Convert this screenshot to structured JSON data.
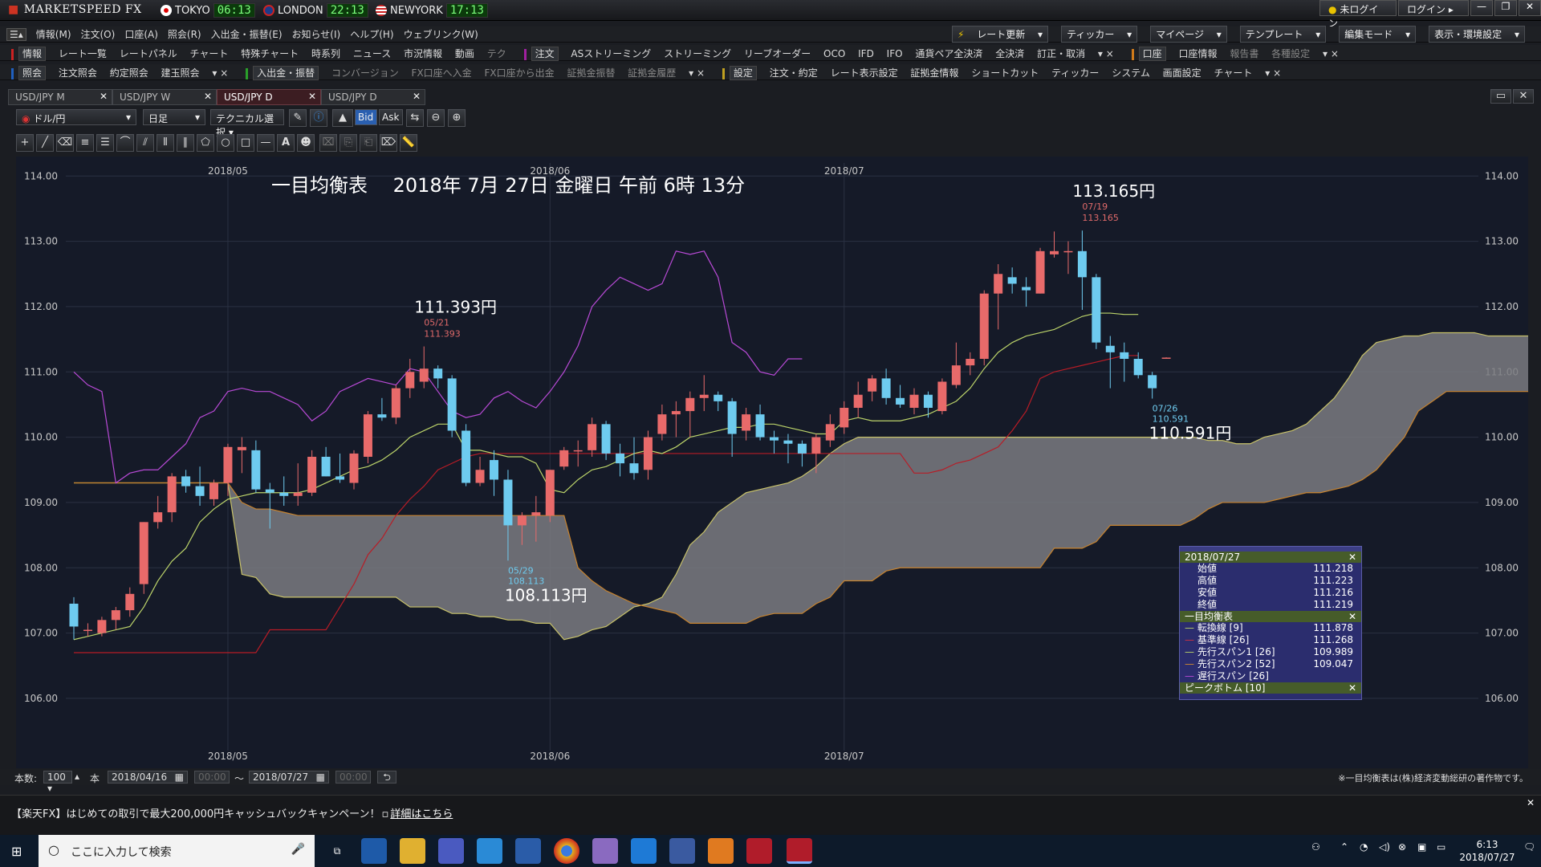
{
  "app": {
    "brand": "MARKETSPEED FX",
    "clocks": [
      {
        "city": "TOKYO",
        "time": "06:13"
      },
      {
        "city": "LONDON",
        "time": "22:13"
      },
      {
        "city": "NEWYORK",
        "time": "17:13"
      }
    ],
    "top_buttons": [
      "未ログイン",
      "ログイン"
    ]
  },
  "menu": [
    "情報(M)",
    "注文(O)",
    "口座(A)",
    "照会(R)",
    "入出金・振替(E)",
    "お知らせ(I)",
    "ヘルプ(H)",
    "ウェブリンク(W)"
  ],
  "menu_right": [
    "レート更新",
    "ティッカー",
    "マイページ",
    "テンプレート",
    "編集モード",
    "表示・環境設定"
  ],
  "toolbar1": {
    "info_tag": "情報",
    "info_items": [
      "レート一覧",
      "レートパネル",
      "チャート",
      "特殊チャート",
      "時系列",
      "ニュース",
      "市況情報",
      "動画",
      "テク"
    ],
    "order_tag": "注文",
    "order_items": [
      "ASストリーミング",
      "ストリーミング",
      "リーブオーダー",
      "OCO",
      "IFD",
      "IFO",
      "通貨ペア全決済",
      "全決済",
      "訂正・取消"
    ],
    "account_tag": "口座",
    "account_items": [
      "口座情報",
      "報告書",
      "各種設定"
    ]
  },
  "toolbar2": {
    "inquiry_tag": "照会",
    "inquiry_items": [
      "注文照会",
      "約定照会",
      "建玉照会"
    ],
    "transfer_tag": "入出金・振替",
    "transfer_items": [
      "コンバージョン",
      "FX口座へ入金",
      "FX口座から出金",
      "証拠金振替",
      "証拠金履歴"
    ],
    "settings_tag": "設定",
    "settings_items": [
      "注文・約定",
      "レート表示設定",
      "証拠金情報",
      "ショートカット",
      "ティッカー",
      "システム",
      "画面設定",
      "チャート"
    ]
  },
  "tabs": [
    {
      "label": "USD/JPY M",
      "active": false
    },
    {
      "label": "USD/JPY W",
      "active": false
    },
    {
      "label": "USD/JPY D",
      "active": true
    },
    {
      "label": "USD/JPY D",
      "active": false
    }
  ],
  "chart_toolbar": {
    "pair": "ドル/円",
    "period": "日足",
    "technical": "テクニカル選択",
    "bid": "Bid",
    "ask": "Ask"
  },
  "chart_data": {
    "type": "candlestick",
    "title": "一目均衡表　 2018年 7月 27日 金曜日 午前 6時 13分",
    "y_ticks": [
      "114.00",
      "113.00",
      "112.00",
      "111.00",
      "110.00",
      "109.00",
      "108.00",
      "107.00",
      "106.00"
    ],
    "ylim": [
      105.2,
      114.2
    ],
    "x_labels": [
      {
        "label": "2018/05",
        "index": 11
      },
      {
        "label": "2018/06",
        "index": 34
      },
      {
        "label": "2018/07",
        "index": 55
      }
    ],
    "annotations": [
      {
        "label": "111.393円",
        "date": "05/21",
        "value": "111.393",
        "index": 25
      },
      {
        "label": "108.113円",
        "date": "05/29",
        "value": "108.113",
        "index": 31
      },
      {
        "label": "113.165円",
        "date": "07/19",
        "value": "113.165",
        "index": 72
      },
      {
        "label": "110.591円",
        "date": "07/26",
        "value": "110.591",
        "index": 77
      }
    ],
    "candles": [
      {
        "o": 107.45,
        "h": 107.55,
        "l": 106.9,
        "c": 107.1
      },
      {
        "o": 107.05,
        "h": 107.15,
        "l": 106.95,
        "c": 107.05
      },
      {
        "o": 107.0,
        "h": 107.25,
        "l": 106.95,
        "c": 107.2
      },
      {
        "o": 107.2,
        "h": 107.4,
        "l": 107.05,
        "c": 107.35
      },
      {
        "o": 107.35,
        "h": 107.7,
        "l": 107.25,
        "c": 107.6
      },
      {
        "o": 107.75,
        "h": 108.7,
        "l": 107.6,
        "c": 108.7
      },
      {
        "o": 108.7,
        "h": 109.1,
        "l": 108.6,
        "c": 108.85
      },
      {
        "o": 108.85,
        "h": 109.45,
        "l": 108.7,
        "c": 109.4
      },
      {
        "o": 109.4,
        "h": 109.5,
        "l": 109.15,
        "c": 109.25
      },
      {
        "o": 109.25,
        "h": 109.55,
        "l": 108.95,
        "c": 109.1
      },
      {
        "o": 109.05,
        "h": 109.35,
        "l": 108.95,
        "c": 109.3
      },
      {
        "o": 109.3,
        "h": 109.9,
        "l": 109.1,
        "c": 109.85
      },
      {
        "o": 109.8,
        "h": 110.0,
        "l": 109.45,
        "c": 109.85
      },
      {
        "o": 109.8,
        "h": 109.95,
        "l": 109.15,
        "c": 109.2
      },
      {
        "o": 109.2,
        "h": 109.3,
        "l": 108.6,
        "c": 109.15
      },
      {
        "o": 109.15,
        "h": 109.4,
        "l": 108.95,
        "c": 109.1
      },
      {
        "o": 109.1,
        "h": 109.6,
        "l": 108.95,
        "c": 109.15
      },
      {
        "o": 109.15,
        "h": 109.8,
        "l": 109.1,
        "c": 109.7
      },
      {
        "o": 109.7,
        "h": 109.85,
        "l": 109.4,
        "c": 109.4
      },
      {
        "o": 109.4,
        "h": 109.75,
        "l": 109.3,
        "c": 109.35
      },
      {
        "o": 109.3,
        "h": 109.8,
        "l": 109.2,
        "c": 109.75
      },
      {
        "o": 109.7,
        "h": 110.4,
        "l": 109.6,
        "c": 110.35
      },
      {
        "o": 110.35,
        "h": 110.6,
        "l": 110.25,
        "c": 110.3
      },
      {
        "o": 110.3,
        "h": 110.8,
        "l": 110.2,
        "c": 110.75
      },
      {
        "o": 110.75,
        "h": 111.2,
        "l": 110.6,
        "c": 111.0
      },
      {
        "o": 110.85,
        "h": 111.39,
        "l": 110.75,
        "c": 111.05
      },
      {
        "o": 111.05,
        "h": 111.1,
        "l": 110.75,
        "c": 110.9
      },
      {
        "o": 110.9,
        "h": 110.95,
        "l": 110.0,
        "c": 110.1
      },
      {
        "o": 110.1,
        "h": 110.2,
        "l": 109.25,
        "c": 109.3
      },
      {
        "o": 109.3,
        "h": 109.7,
        "l": 109.25,
        "c": 109.5
      },
      {
        "o": 109.65,
        "h": 109.8,
        "l": 109.1,
        "c": 109.35
      },
      {
        "o": 109.35,
        "h": 109.5,
        "l": 108.11,
        "c": 108.65
      },
      {
        "o": 108.65,
        "h": 108.85,
        "l": 108.35,
        "c": 108.8
      },
      {
        "o": 108.8,
        "h": 109.1,
        "l": 108.4,
        "c": 108.85
      },
      {
        "o": 108.8,
        "h": 109.5,
        "l": 108.7,
        "c": 109.5
      },
      {
        "o": 109.55,
        "h": 109.85,
        "l": 109.5,
        "c": 109.8
      },
      {
        "o": 109.8,
        "h": 109.95,
        "l": 109.55,
        "c": 109.8
      },
      {
        "o": 109.8,
        "h": 110.3,
        "l": 109.7,
        "c": 110.2
      },
      {
        "o": 110.2,
        "h": 110.25,
        "l": 109.65,
        "c": 109.75
      },
      {
        "o": 109.75,
        "h": 109.9,
        "l": 109.4,
        "c": 109.6
      },
      {
        "o": 109.6,
        "h": 110.0,
        "l": 109.35,
        "c": 109.45
      },
      {
        "o": 109.5,
        "h": 110.1,
        "l": 109.35,
        "c": 110.0
      },
      {
        "o": 110.05,
        "h": 110.5,
        "l": 109.95,
        "c": 110.35
      },
      {
        "o": 110.35,
        "h": 110.55,
        "l": 110.0,
        "c": 110.4
      },
      {
        "o": 110.4,
        "h": 110.7,
        "l": 110.0,
        "c": 110.6
      },
      {
        "o": 110.6,
        "h": 110.95,
        "l": 110.4,
        "c": 110.65
      },
      {
        "o": 110.65,
        "h": 110.7,
        "l": 110.4,
        "c": 110.55
      },
      {
        "o": 110.55,
        "h": 110.6,
        "l": 109.7,
        "c": 110.05
      },
      {
        "o": 110.1,
        "h": 110.45,
        "l": 109.95,
        "c": 110.35
      },
      {
        "o": 110.35,
        "h": 110.5,
        "l": 109.95,
        "c": 110.0
      },
      {
        "o": 110.0,
        "h": 110.1,
        "l": 109.75,
        "c": 109.95
      },
      {
        "o": 109.95,
        "h": 110.05,
        "l": 109.6,
        "c": 109.9
      },
      {
        "o": 109.9,
        "h": 109.95,
        "l": 109.55,
        "c": 109.75
      },
      {
        "o": 109.75,
        "h": 110.05,
        "l": 109.45,
        "c": 110.0
      },
      {
        "o": 109.95,
        "h": 110.35,
        "l": 109.85,
        "c": 110.2
      },
      {
        "o": 110.15,
        "h": 110.55,
        "l": 110.05,
        "c": 110.45
      },
      {
        "o": 110.45,
        "h": 110.85,
        "l": 110.3,
        "c": 110.65
      },
      {
        "o": 110.7,
        "h": 110.95,
        "l": 110.55,
        "c": 110.9
      },
      {
        "o": 110.9,
        "h": 111.05,
        "l": 110.5,
        "c": 110.6
      },
      {
        "o": 110.6,
        "h": 110.8,
        "l": 110.45,
        "c": 110.5
      },
      {
        "o": 110.45,
        "h": 110.75,
        "l": 110.35,
        "c": 110.65
      },
      {
        "o": 110.65,
        "h": 110.7,
        "l": 110.3,
        "c": 110.45
      },
      {
        "o": 110.4,
        "h": 110.9,
        "l": 110.35,
        "c": 110.85
      },
      {
        "o": 110.8,
        "h": 111.45,
        "l": 110.75,
        "c": 111.1
      },
      {
        "o": 111.1,
        "h": 111.3,
        "l": 110.95,
        "c": 111.2
      },
      {
        "o": 111.2,
        "h": 112.25,
        "l": 111.1,
        "c": 112.2
      },
      {
        "o": 112.2,
        "h": 112.65,
        "l": 111.65,
        "c": 112.5
      },
      {
        "o": 112.45,
        "h": 112.6,
        "l": 112.2,
        "c": 112.35
      },
      {
        "o": 112.3,
        "h": 112.45,
        "l": 112.0,
        "c": 112.25
      },
      {
        "o": 112.2,
        "h": 112.9,
        "l": 112.2,
        "c": 112.85
      },
      {
        "o": 112.8,
        "h": 113.15,
        "l": 112.75,
        "c": 112.85
      },
      {
        "o": 112.85,
        "h": 113.0,
        "l": 112.5,
        "c": 112.85
      },
      {
        "o": 112.85,
        "h": 113.165,
        "l": 111.95,
        "c": 112.45
      },
      {
        "o": 112.45,
        "h": 112.5,
        "l": 111.35,
        "c": 111.45
      },
      {
        "o": 111.4,
        "h": 111.55,
        "l": 110.75,
        "c": 111.3
      },
      {
        "o": 111.3,
        "h": 111.45,
        "l": 110.85,
        "c": 111.2
      },
      {
        "o": 111.2,
        "h": 111.3,
        "l": 110.9,
        "c": 110.95
      },
      {
        "o": 110.95,
        "h": 111.0,
        "l": 110.591,
        "c": 110.75
      },
      {
        "o": 111.218,
        "h": 111.223,
        "l": 111.216,
        "c": 111.219
      }
    ],
    "span1": [
      109.3,
      109.3,
      109.3,
      109.3,
      109.3,
      109.3,
      109.3,
      109.3,
      109.3,
      109.3,
      109.3,
      109.3,
      107.9,
      107.85,
      107.6,
      107.55,
      107.55,
      107.55,
      107.55,
      107.55,
      107.55,
      107.55,
      107.55,
      107.55,
      107.4,
      107.4,
      107.4,
      107.3,
      107.3,
      107.25,
      107.25,
      107.2,
      107.2,
      107.15,
      107.15,
      106.9,
      106.95,
      107.05,
      107.1,
      107.25,
      107.4,
      107.45,
      107.55,
      107.9,
      108.35,
      108.55,
      108.85,
      109.0,
      109.15,
      109.2,
      109.25,
      109.3,
      109.4,
      109.55,
      109.75,
      109.9,
      110.0,
      110.0,
      110.0,
      110.0,
      110.0,
      110.0,
      110.0,
      110.0,
      110.0,
      110.0,
      110.0,
      110.0,
      110.0,
      110.0,
      110.0,
      110.0,
      110.0,
      110.0,
      110.0,
      110.0,
      110.0,
      110.0,
      110.0,
      110.0,
      110.0,
      109.95,
      109.95,
      109.9,
      109.9,
      110.0,
      110.05,
      110.1,
      110.2,
      110.4,
      110.6,
      110.9,
      111.25,
      111.45,
      111.5,
      111.55,
      111.55,
      111.6,
      111.6,
      111.6,
      111.6,
      111.55,
      111.55,
      111.55,
      111.55,
      111.55
    ],
    "span2": [
      109.3,
      109.3,
      109.3,
      109.3,
      109.3,
      109.3,
      109.3,
      109.3,
      109.3,
      109.3,
      109.3,
      109.3,
      109.0,
      108.9,
      108.9,
      108.85,
      108.8,
      108.8,
      108.8,
      108.8,
      108.8,
      108.8,
      108.8,
      108.8,
      108.8,
      108.8,
      108.8,
      108.8,
      108.8,
      108.8,
      108.8,
      108.8,
      108.8,
      108.8,
      108.8,
      108.8,
      108.0,
      107.8,
      107.65,
      107.55,
      107.45,
      107.4,
      107.35,
      107.3,
      107.15,
      107.15,
      107.15,
      107.15,
      107.15,
      107.25,
      107.3,
      107.3,
      107.3,
      107.45,
      107.55,
      107.8,
      107.8,
      107.8,
      107.95,
      108.0,
      108.0,
      108.0,
      108.0,
      108.0,
      108.0,
      108.0,
      108.0,
      108.0,
      108.0,
      108.0,
      108.3,
      108.3,
      108.3,
      108.4,
      108.65,
      108.65,
      108.65,
      108.65,
      108.65,
      108.65,
      108.75,
      108.9,
      109.0,
      109.0,
      109.0,
      109.0,
      109.05,
      109.1,
      109.15,
      109.15,
      109.2,
      109.25,
      109.35,
      109.5,
      109.75,
      110.0,
      110.4,
      110.55,
      110.7,
      110.7,
      110.7,
      110.7,
      110.7,
      110.7,
      110.7,
      110.7
    ],
    "tenkan": [
      106.9,
      106.95,
      107.0,
      107.05,
      107.1,
      107.4,
      107.8,
      108.1,
      108.3,
      108.7,
      108.9,
      109.05,
      109.1,
      109.15,
      109.15,
      109.15,
      109.15,
      109.2,
      109.3,
      109.4,
      109.5,
      109.55,
      109.65,
      109.8,
      110.0,
      110.1,
      110.2,
      110.2,
      109.8,
      109.8,
      109.75,
      109.7,
      109.7,
      109.6,
      109.2,
      109.15,
      109.35,
      109.5,
      109.55,
      109.65,
      109.75,
      109.8,
      109.75,
      109.85,
      110.0,
      110.05,
      110.1,
      110.15,
      110.15,
      110.2,
      110.2,
      110.15,
      110.1,
      110.05,
      110.05,
      110.25,
      110.3,
      110.25,
      110.25,
      110.25,
      110.3,
      110.35,
      110.45,
      110.55,
      110.75,
      111.05,
      111.3,
      111.45,
      111.55,
      111.6,
      111.65,
      111.75,
      111.85,
      111.9,
      111.9,
      111.88,
      111.88
    ],
    "kijun": [
      106.7,
      106.7,
      106.7,
      106.7,
      106.7,
      106.7,
      106.7,
      106.7,
      106.7,
      106.7,
      106.7,
      106.7,
      106.7,
      106.7,
      107.05,
      107.05,
      107.05,
      107.05,
      107.05,
      107.4,
      107.75,
      108.2,
      108.45,
      108.8,
      109.05,
      109.25,
      109.5,
      109.6,
      109.7,
      109.75,
      109.75,
      109.75,
      109.75,
      109.75,
      109.75,
      109.75,
      109.75,
      109.75,
      109.75,
      109.75,
      109.75,
      109.75,
      109.75,
      109.75,
      109.75,
      109.75,
      109.75,
      109.75,
      109.75,
      109.75,
      109.75,
      109.75,
      109.75,
      109.75,
      109.75,
      109.75,
      109.75,
      109.75,
      109.75,
      109.75,
      109.45,
      109.45,
      109.5,
      109.6,
      109.65,
      109.75,
      109.85,
      110.1,
      110.4,
      110.9,
      111.0,
      111.05,
      111.1,
      111.15,
      111.2,
      111.25,
      111.25
    ],
    "chikou": [
      111.0,
      110.8,
      110.7,
      109.3,
      109.45,
      109.5,
      109.5,
      109.7,
      109.9,
      110.3,
      110.4,
      110.7,
      110.75,
      110.7,
      110.7,
      110.6,
      110.5,
      110.25,
      110.4,
      110.7,
      110.8,
      110.9,
      110.85,
      110.8,
      111.05,
      111.0,
      110.7,
      110.4,
      110.3,
      110.35,
      110.6,
      110.7,
      110.55,
      110.45,
      110.7,
      111.0,
      111.4,
      112.0,
      112.25,
      112.45,
      112.35,
      112.25,
      112.35,
      112.85,
      112.8,
      112.85,
      112.45,
      111.45,
      111.3,
      111.0,
      110.95,
      111.2,
      111.2
    ],
    "info_panel": {
      "date": "2018/07/27",
      "ohlc": [
        {
          "label": "始値",
          "value": "111.218"
        },
        {
          "label": "高値",
          "value": "111.223"
        },
        {
          "label": "安値",
          "value": "111.216"
        },
        {
          "label": "終値",
          "value": "111.219"
        }
      ],
      "ichimoku_header": "一目均衡表",
      "ichimoku": [
        {
          "label": "転換線 [9]",
          "value": "111.878"
        },
        {
          "label": "基準線 [26]",
          "value": "111.268"
        },
        {
          "label": "先行スパン1 [26]",
          "value": "109.989"
        },
        {
          "label": "先行スパン2 [52]",
          "value": "109.047"
        },
        {
          "label": "遅行スパン [26]",
          "value": ""
        }
      ],
      "peak_header": "ピークボトム [10]"
    },
    "colors": {
      "bg": "#151a28",
      "up": "#e86a6a",
      "down": "#6ecbef",
      "tenkan": "#bcd46a",
      "kijun": "#b81c26",
      "chikou": "#b84ad6",
      "cloud": "#7a7b80"
    }
  },
  "bottom": {
    "count_label": "本数:",
    "count_value": "100",
    "count_unit": "本",
    "from_date": "2018/04/16",
    "from_time": "00:00",
    "tilde": "～",
    "to_date": "2018/07/27",
    "to_time": "00:00",
    "copyright": "※一目均衡表は(株)経済変動総研の著作物です。"
  },
  "ticker": {
    "message": "【楽天FX】はじめての取引で最大200,000円キャッシュバックキャンペーン！",
    "link": "詳細はこちら"
  },
  "taskbar": {
    "search_placeholder": "ここに入力して検索",
    "time": "6:13",
    "date": "2018/07/27"
  }
}
